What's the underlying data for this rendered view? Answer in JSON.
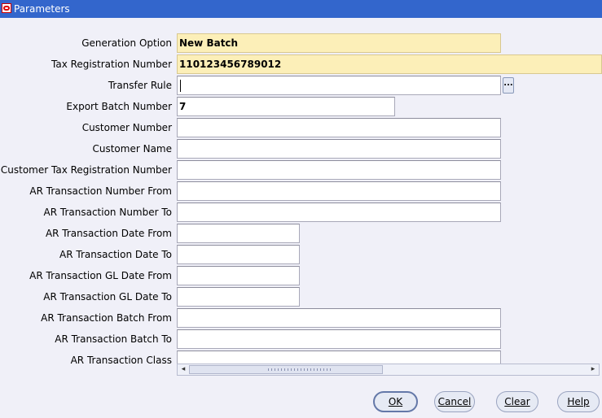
{
  "window": {
    "title": "Parameters"
  },
  "fields": [
    {
      "label": "Generation Option",
      "value": "New Batch"
    },
    {
      "label": "Tax Registration Number",
      "value": "110123456789012"
    },
    {
      "label": "Transfer Rule",
      "value": "",
      "lov": "..."
    },
    {
      "label": "Export Batch Number",
      "value": "7"
    },
    {
      "label": "Customer Number",
      "value": ""
    },
    {
      "label": "Customer Name",
      "value": ""
    },
    {
      "label": "Customer Tax Registration Number",
      "value": ""
    },
    {
      "label": "AR Transaction Number From",
      "value": ""
    },
    {
      "label": "AR Transaction Number To",
      "value": ""
    },
    {
      "label": "AR Transaction Date From",
      "value": ""
    },
    {
      "label": "AR Transaction Date To",
      "value": ""
    },
    {
      "label": "AR Transaction GL Date From",
      "value": ""
    },
    {
      "label": "AR Transaction GL Date To",
      "value": ""
    },
    {
      "label": "AR Transaction Batch From",
      "value": ""
    },
    {
      "label": "AR Transaction Batch To",
      "value": ""
    },
    {
      "label": "AR Transaction Class",
      "value": ""
    }
  ],
  "scrollbar": {
    "left_arrow": "◂",
    "right_arrow": "▸"
  },
  "buttons": {
    "ok": "OK",
    "cancel": "Cancel",
    "clear": "Clear",
    "help": "Help"
  },
  "colors": {
    "title_bar": "#3366cc",
    "required_field": "#fcefb8",
    "background": "#f0f0f8"
  }
}
